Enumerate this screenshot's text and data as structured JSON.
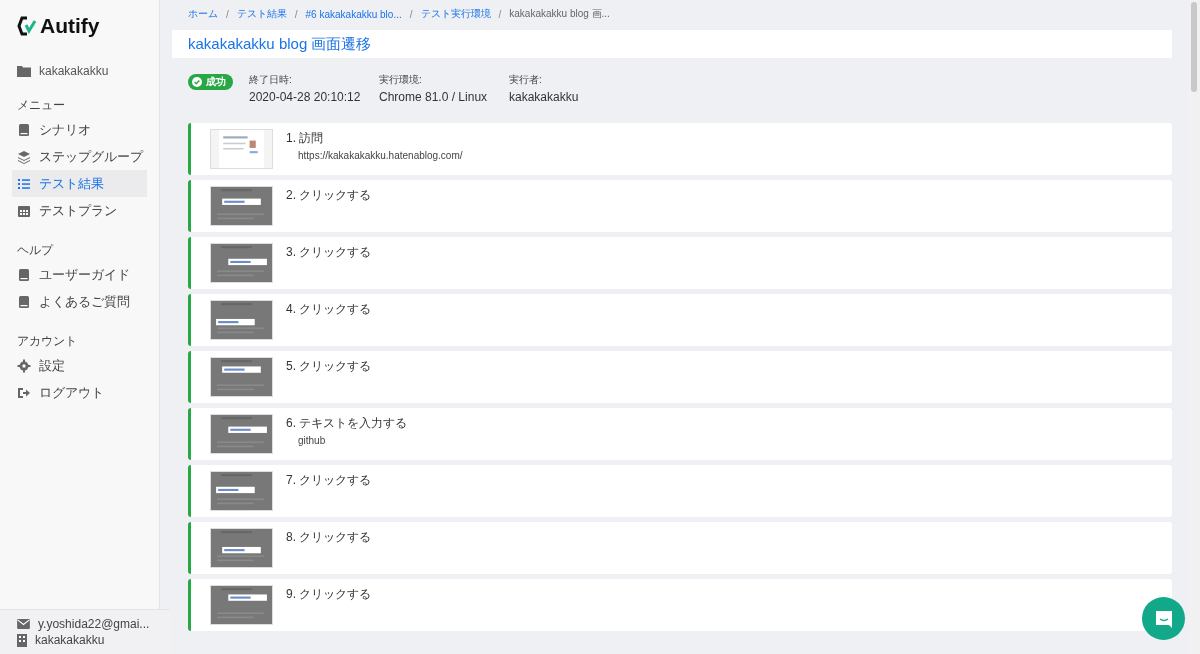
{
  "sidebar": {
    "logo": "Autify",
    "project": "kakakakakku",
    "sections": [
      {
        "heading": "メニュー",
        "items": [
          {
            "label": "シナリオ",
            "selected": false
          },
          {
            "label": "ステップグループ",
            "selected": false
          },
          {
            "label": "テスト結果",
            "selected": true
          },
          {
            "label": "テストプラン",
            "selected": false
          }
        ]
      },
      {
        "heading": "ヘルプ",
        "items": [
          {
            "label": "ユーザーガイド",
            "selected": false
          },
          {
            "label": "よくあるご質問",
            "selected": false
          }
        ]
      },
      {
        "heading": "アカウント",
        "items": [
          {
            "label": "設定",
            "selected": false
          },
          {
            "label": "ログアウト",
            "selected": false
          }
        ]
      }
    ],
    "footer": [
      "y.yoshida22@gmai...",
      "kakakakakku"
    ]
  },
  "breadcrumb": [
    {
      "kind": "link",
      "label": "ホーム"
    },
    {
      "kind": "separator",
      "label": "/"
    },
    {
      "kind": "link",
      "label": "テスト結果"
    },
    {
      "kind": "separator",
      "label": "/"
    },
    {
      "kind": "link",
      "label": "#6 kakakakakku blo..."
    },
    {
      "kind": "separator",
      "label": "/"
    },
    {
      "kind": "link",
      "label": "テスト実行環境"
    },
    {
      "kind": "separator",
      "label": "/"
    },
    {
      "kind": "current",
      "label": "kakakakakku blog 画..."
    }
  ],
  "title": "kakakakakku blog 画面遷移",
  "status": {
    "label": "成功",
    "kind": "success"
  },
  "meta": [
    {
      "label": "終了日時:",
      "value": "2020-04-28 20:10:12"
    },
    {
      "label": "実行環境:",
      "value": "Chrome 81.0 / Linux"
    },
    {
      "label": "実行者:",
      "value": "kakakakakku"
    }
  ],
  "steps": [
    {
      "title": "1. 訪問",
      "detail": "https://kakakakakku.hatenablog.com/"
    },
    {
      "title": "2. クリックする"
    },
    {
      "title": "3. クリックする"
    },
    {
      "title": "4. クリックする"
    },
    {
      "title": "5. クリックする"
    },
    {
      "title": "6. テキストを入力する",
      "detail": "github"
    },
    {
      "title": "7. クリックする"
    },
    {
      "title": "8. クリックする"
    },
    {
      "title": "9. クリックする"
    }
  ]
}
